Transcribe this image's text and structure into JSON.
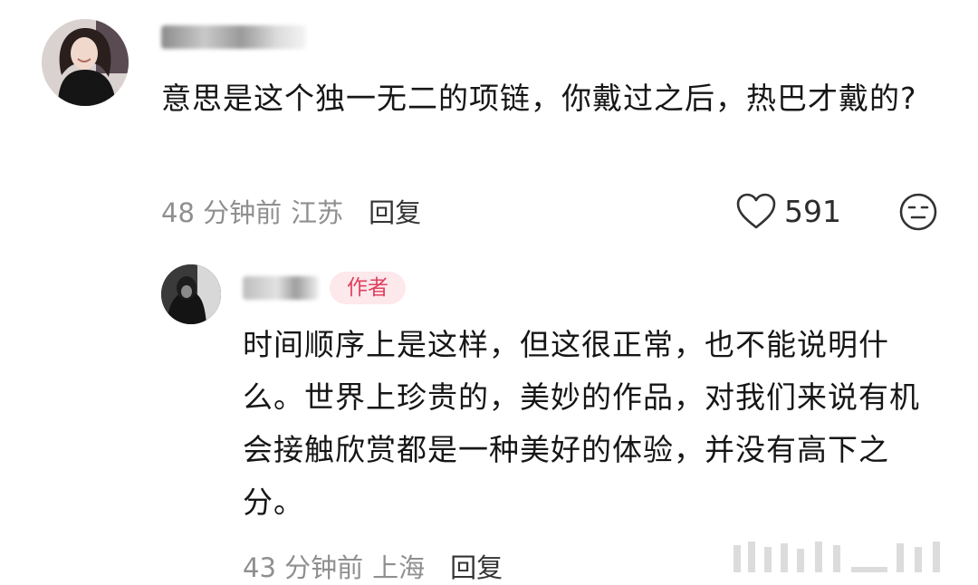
{
  "comment": {
    "text": "意思是这个独一无二的项链，你戴过之后，热巴才戴的?",
    "time": "48 分钟前",
    "location": "江苏",
    "reply_label": "回复",
    "like_count": "591"
  },
  "reply": {
    "author_tag": "作者",
    "text": "时间顺序上是这样，但这很正常，也不能说明什么。世界上珍贵的，美妙的作品，对我们来说有机会接触欣赏都是一种美好的体验，并没有高下之分。",
    "time": "43 分钟前",
    "location": "上海",
    "reply_label": "回复"
  },
  "icons": {
    "like": "heart-icon",
    "dislike": "neutral-face-icon"
  },
  "colors": {
    "author_tag_bg": "#fde8ec",
    "author_tag_text": "#e0405e",
    "meta_text": "#8f8f8f"
  }
}
